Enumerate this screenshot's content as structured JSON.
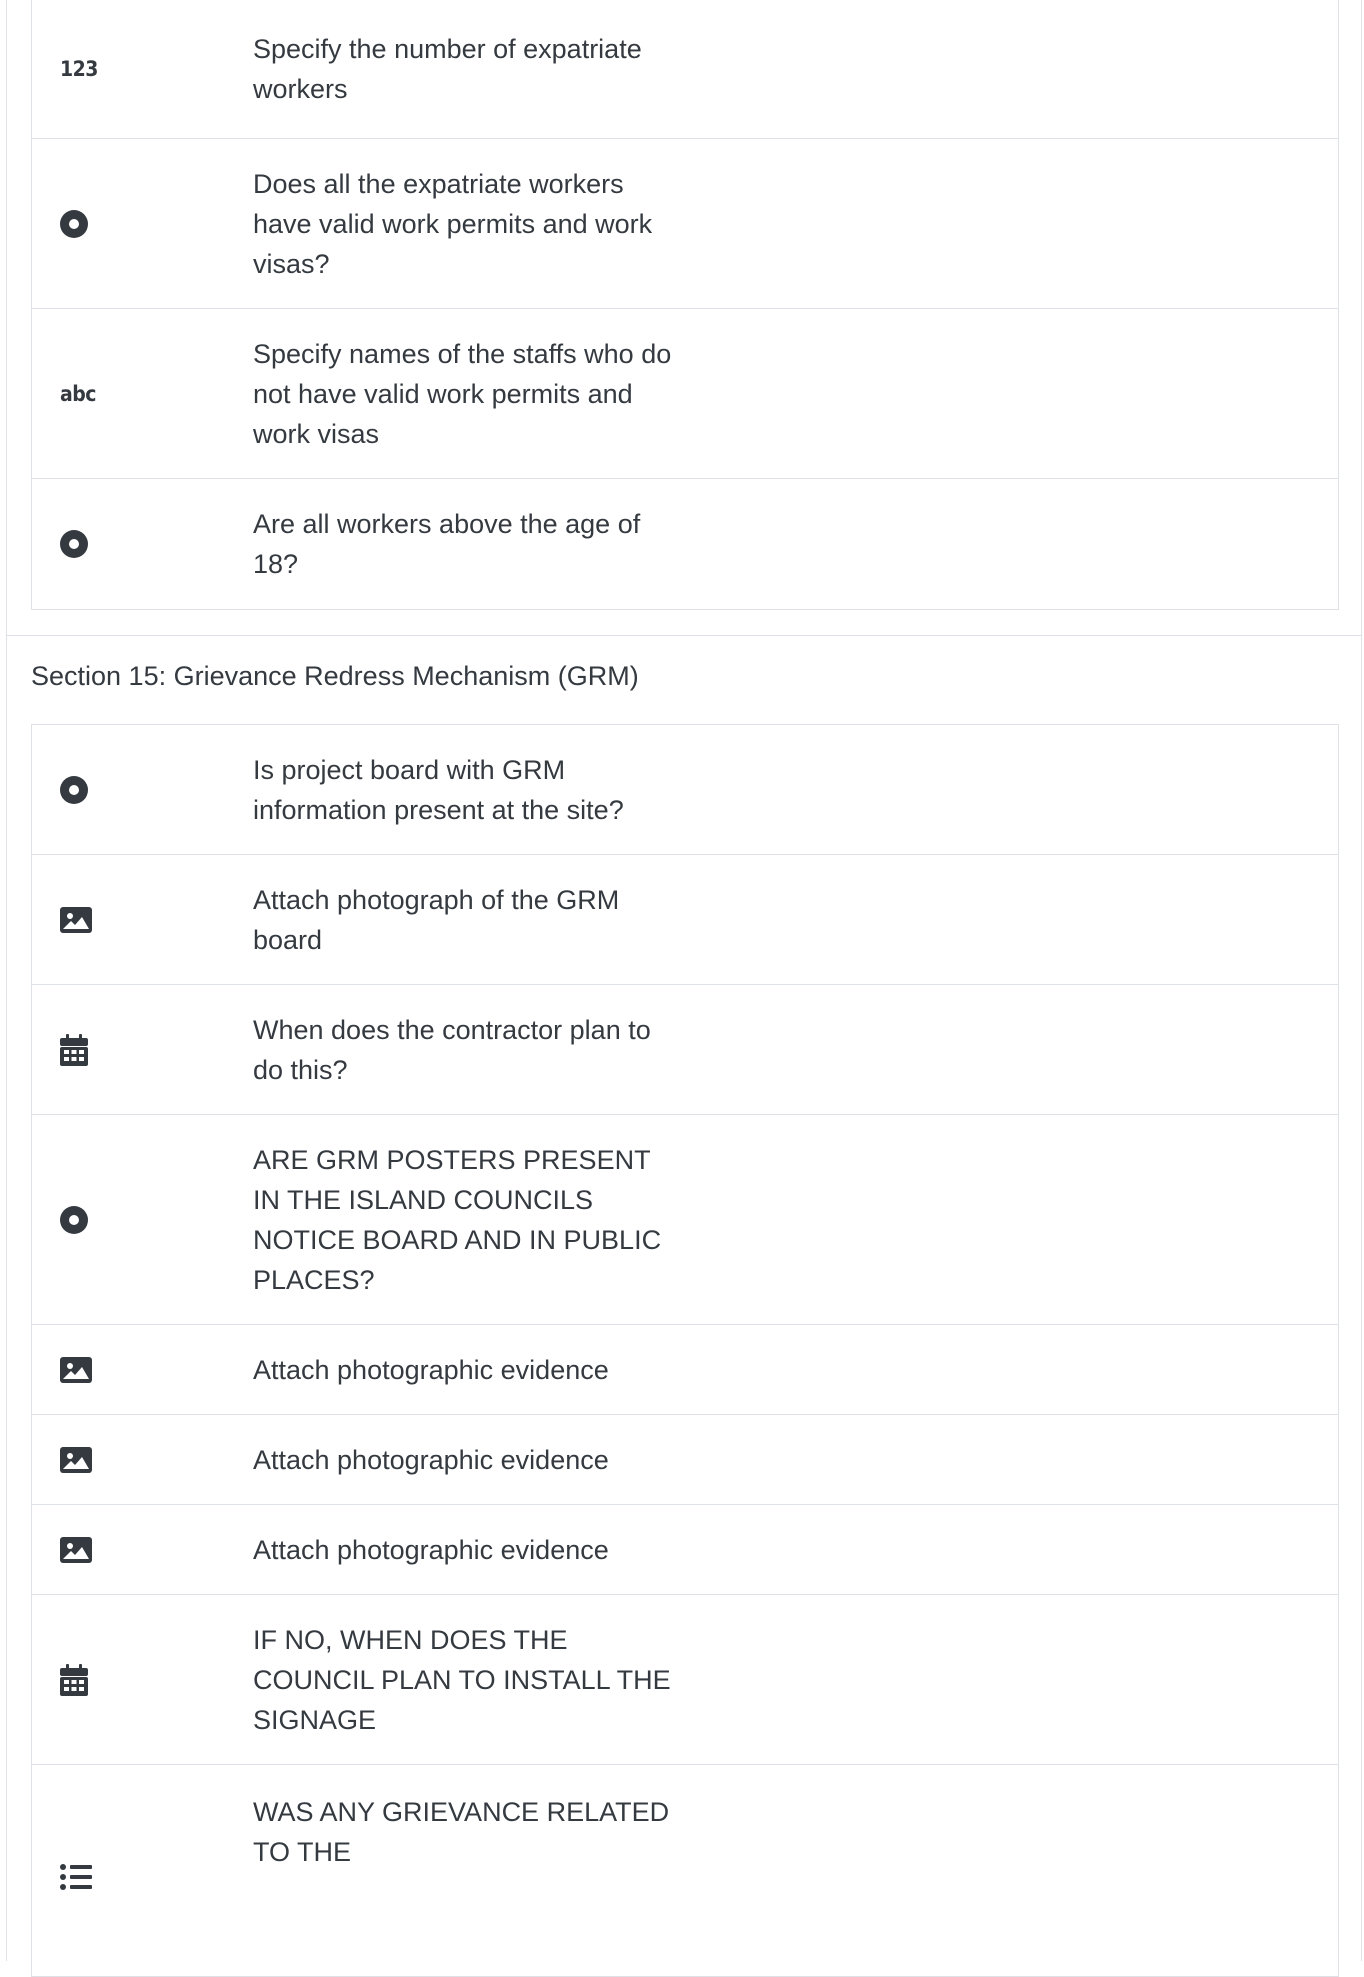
{
  "section_14": {
    "rows": [
      {
        "icon": "number-icon",
        "icon_text": "123",
        "label": "Specify the number of expatriate workers"
      },
      {
        "icon": "radio-icon",
        "label": "Does all the expatriate workers have valid work permits and work visas?"
      },
      {
        "icon": "text-icon",
        "icon_text": "abc",
        "label": "Specify names of the staffs who do not have valid work permits and work visas"
      },
      {
        "icon": "radio-icon",
        "label": "Are all workers above the age of 18?"
      }
    ]
  },
  "section_15": {
    "title": "Section 15: Grievance Redress Mechanism (GRM)",
    "rows": [
      {
        "icon": "radio-icon",
        "label": "Is project board with GRM information present at the site?"
      },
      {
        "icon": "image-icon",
        "label": "Attach photograph of the GRM board"
      },
      {
        "icon": "calendar-icon",
        "label": "When does the contractor plan to do this?"
      },
      {
        "icon": "radio-icon",
        "label": "ARE GRM POSTERS PRESENT IN THE ISLAND COUNCILS NOTICE BOARD AND IN PUBLIC PLACES?"
      },
      {
        "icon": "image-icon",
        "label": "Attach photographic evidence"
      },
      {
        "icon": "image-icon",
        "label": "Attach photographic evidence"
      },
      {
        "icon": "image-icon",
        "label": "Attach photographic evidence"
      },
      {
        "icon": "calendar-icon",
        "label": "IF NO, WHEN DOES THE COUNCIL PLAN TO INSTALL THE SIGNAGE"
      },
      {
        "icon": "list-icon",
        "label": "WAS ANY GRIEVANCE RELATED TO THE"
      }
    ]
  }
}
